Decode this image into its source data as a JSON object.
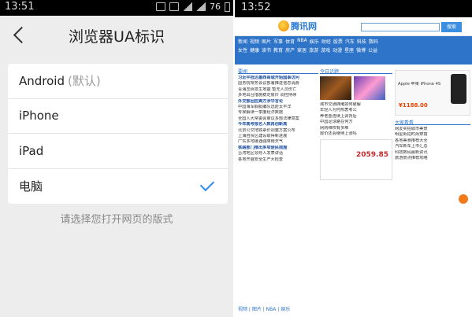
{
  "left": {
    "status_time": "13:51",
    "battery": "76",
    "title": "浏览器UA标识",
    "options": [
      {
        "label": "Android",
        "suffix": "(默认)",
        "selected": false
      },
      {
        "label": "iPhone",
        "suffix": "",
        "selected": false
      },
      {
        "label": "iPad",
        "suffix": "",
        "selected": false
      },
      {
        "label": "电脑",
        "suffix": "",
        "selected": true
      }
    ],
    "hint": "请选择您打开网页的版式",
    "accent_color": "#2e8bf0"
  },
  "right": {
    "status_time": "13:52",
    "site_name": "腾讯网",
    "search_btn": "搜索",
    "nav_rows": [
      [
        "新闻",
        "视频",
        "图片",
        "军事",
        "体育",
        "NBA",
        "娱乐",
        "财经",
        "股票",
        "汽车",
        "科技",
        "数码"
      ],
      [
        "女性",
        "健康",
        "读书",
        "教育",
        "房产",
        "家居",
        "旅游",
        "游戏",
        "动漫",
        "星座",
        "微博",
        "公益"
      ]
    ],
    "left_tab": "要闻",
    "left_lines": [
      "习近平抵达墨西哥城开始国事访问",
      "国务院常务会议部署推进信息消费",
      "青海玉树发生地震 暂无人员伤亡",
      "多地出台措施稳定房价 调控持续",
      "外交部回应美方涉华言论",
      "中国海军舰艇编队远赴太平洋",
      "专家解读一季度经济数据",
      "全国人大常委会审议多部法律草案",
      "今年高考报名人数再创新高",
      "北京公交地铁票价调整方案公布",
      "上海自贸区建设取得新进展",
      "广东多地遭遇强降雨天气",
      "铁路部门推出多项便民措施",
      "台湾地区领导人发表讲话",
      "各地开展安全生产大检查"
    ],
    "mid_tab": "今日话题",
    "mid_lines": [
      "城市交通拥堵如何破解",
      "年轻人为何热衷考公",
      "养老金连续上调背后",
      "中国足球路在何方",
      "网购维权有多难",
      "房价还会继续上涨吗"
    ],
    "stock_value": "2059.85",
    "ad_title": "Apple 苹果 iPhone 4S",
    "ad_price": "¥1188.00",
    "right_tab": "大家看看",
    "right_lines": [
      "网友实拍城市美景",
      "明星街拍时尚穿搭",
      "各地美食推荐大全",
      "汽车新车上市汇总",
      "科技数码最新资讯",
      "旅游景点推荐攻略"
    ],
    "bottom_tabs": "视频 | 图片 | NBA | 娱乐",
    "accent_color": "#2e74c9"
  }
}
